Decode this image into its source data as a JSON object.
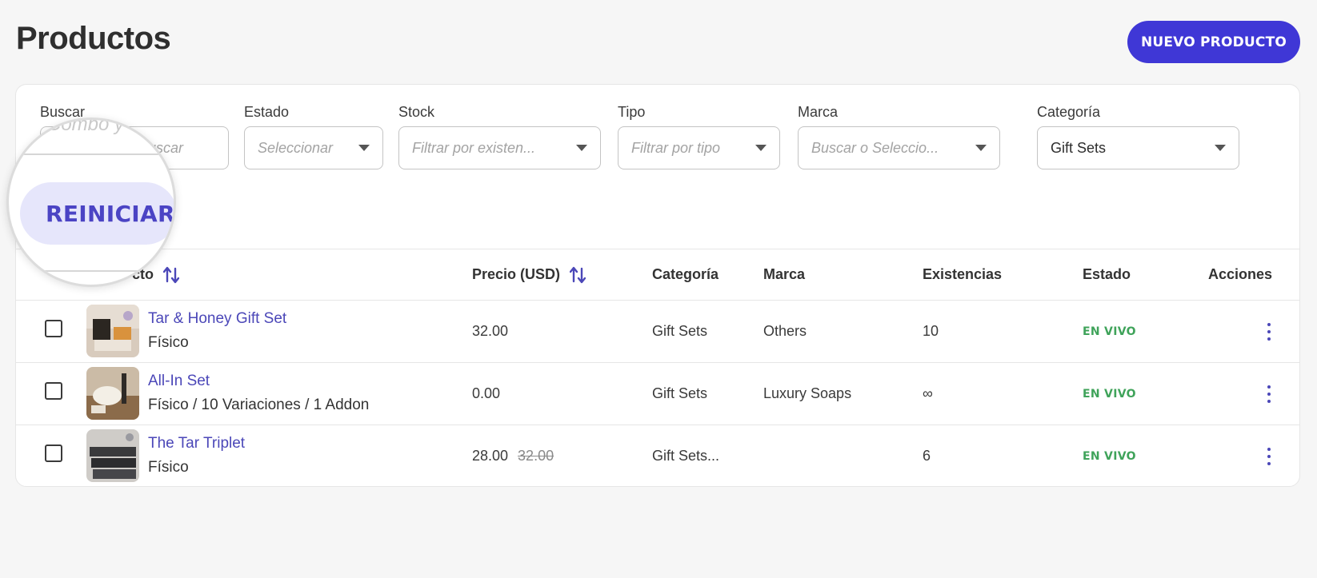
{
  "page": {
    "title": "Productos",
    "new_button": "NUEVO PRODUCTO"
  },
  "filters": {
    "search": {
      "label": "Buscar",
      "placeholder": "buscar",
      "placeholder_magnified": "Combo y"
    },
    "status": {
      "label": "Estado",
      "placeholder": "Seleccionar"
    },
    "stock": {
      "label": "Stock",
      "placeholder": "Filtrar por existen..."
    },
    "type": {
      "label": "Tipo",
      "placeholder": "Filtrar por tipo"
    },
    "brand": {
      "label": "Marca",
      "placeholder": "Buscar o Seleccio..."
    },
    "category": {
      "label": "Categoría",
      "value": "Gift Sets"
    },
    "reset_button": "REINICIAR"
  },
  "table": {
    "columns": {
      "product": "Producto",
      "product_visible": "cto",
      "price": "Precio (USD)",
      "category": "Categoría",
      "brand": "Marca",
      "stock": "Existencias",
      "status": "Estado",
      "actions": "Acciones"
    },
    "rows": [
      {
        "name": "Tar & Honey Gift Set",
        "type": "Físico",
        "price": "32.00",
        "old_price": "",
        "category": "Gift Sets",
        "brand": "Others",
        "stock": "10",
        "status": "EN VIVO"
      },
      {
        "name": "All-In Set",
        "type": "Físico / 10 Variaciones / 1 Addon",
        "price": "0.00",
        "old_price": "",
        "category": "Gift Sets",
        "brand": "Luxury Soaps",
        "stock": "∞",
        "status": "EN VIVO"
      },
      {
        "name": "The Tar Triplet",
        "type": "Físico",
        "price": "28.00",
        "old_price": "32.00",
        "category": "Gift Sets...",
        "brand": "",
        "stock": "6",
        "status": "EN VIVO"
      }
    ]
  },
  "colors": {
    "accent": "#3f37d6",
    "link": "#4b47b8",
    "live": "#3fa35a",
    "reset_bg": "#e6e6fb"
  }
}
